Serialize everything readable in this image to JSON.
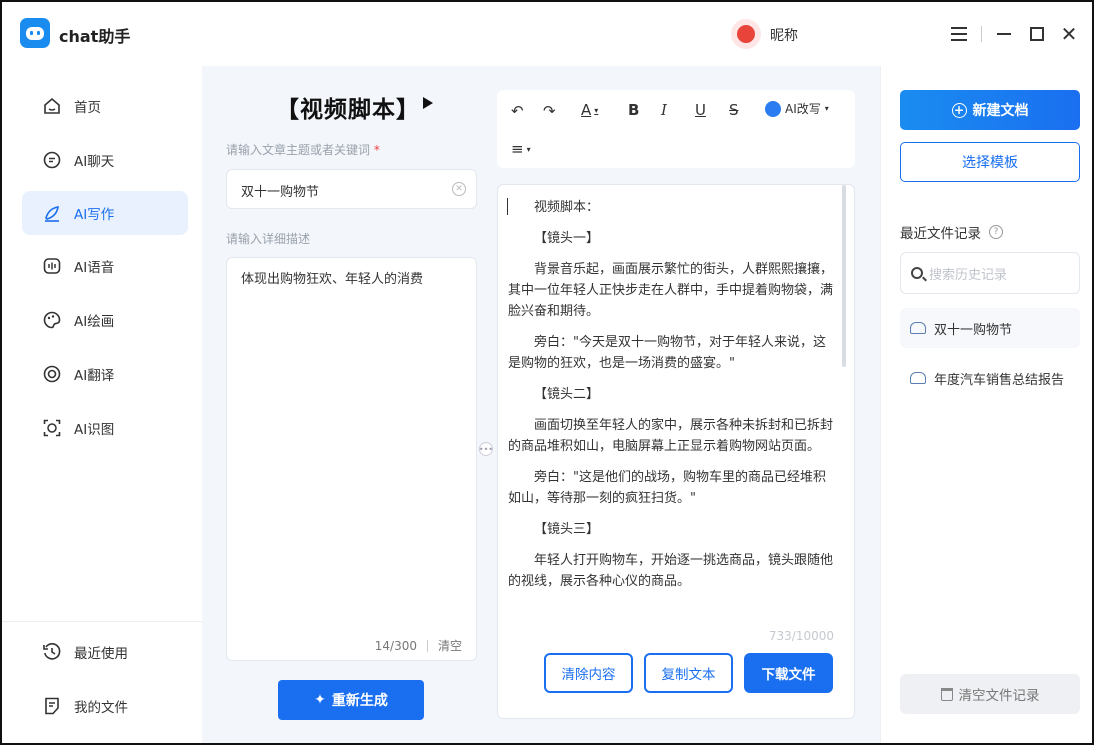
{
  "app": {
    "name": "chat助手",
    "nickname": "昵称"
  },
  "sidebar": {
    "items": [
      {
        "label": "首页",
        "icon": "home-icon"
      },
      {
        "label": "AI聊天",
        "icon": "chat-icon"
      },
      {
        "label": "AI写作",
        "icon": "pen-icon",
        "active": true
      },
      {
        "label": "AI语音",
        "icon": "voice-icon"
      },
      {
        "label": "AI绘画",
        "icon": "palette-icon"
      },
      {
        "label": "AI翻译",
        "icon": "translate-icon"
      },
      {
        "label": "AI识图",
        "icon": "scan-icon"
      }
    ],
    "bottom": [
      {
        "label": "最近使用",
        "icon": "history-icon"
      },
      {
        "label": "我的文件",
        "icon": "file-icon"
      }
    ]
  },
  "editor": {
    "title": "【视频脚本】",
    "topic_label": "请输入文章主题或者关键词",
    "required_mark": "*",
    "topic_value": "双十一购物节",
    "desc_label": "请输入详细描述",
    "desc_value": "体现出购物狂欢、年轻人的消费",
    "desc_count": "14/300",
    "desc_clear": "清空",
    "regenerate": "重新生成"
  },
  "toolbar": {
    "ai_rewrite": "AI改写"
  },
  "content": {
    "paragraphs": [
      {
        "text": "视频脚本：",
        "head": true
      },
      {
        "text": "【镜头一】",
        "head": true
      },
      {
        "text": "背景音乐起，画面展示繁忙的街头，人群熙熙攘攘，其中一位年轻人正快步走在人群中，手中提着购物袋，满脸兴奋和期待。"
      },
      {
        "text": "旁白：\"今天是双十一购物节，对于年轻人来说，这是购物的狂欢，也是一场消费的盛宴。\""
      },
      {
        "text": "【镜头二】",
        "head": true
      },
      {
        "text": "画面切换至年轻人的家中，展示各种未拆封和已拆封的商品堆积如山，电脑屏幕上正显示着购物网站页面。"
      },
      {
        "text": "旁白：\"这是他们的战场，购物车里的商品已经堆积如山，等待那一刻的疯狂扫货。\""
      },
      {
        "text": "【镜头三】",
        "head": true
      },
      {
        "text": "年轻人打开购物车，开始逐一挑选商品，镜头跟随他的视线，展示各种心仪的商品。"
      }
    ],
    "word_count": "733/10000",
    "clear_btn": "清除内容",
    "copy_btn": "复制文本",
    "download_btn": "下载文件"
  },
  "right": {
    "new_doc": "新建文档",
    "choose_template": "选择模板",
    "recent_title": "最近文件记录",
    "search_placeholder": "搜索历史记录",
    "records": [
      "双十一购物节",
      "年度汽车销售总结报告"
    ],
    "clear_records": "清空文件记录"
  },
  "colors": {
    "accent": "#1a6ff0",
    "active_bg": "#e8f1fd"
  }
}
